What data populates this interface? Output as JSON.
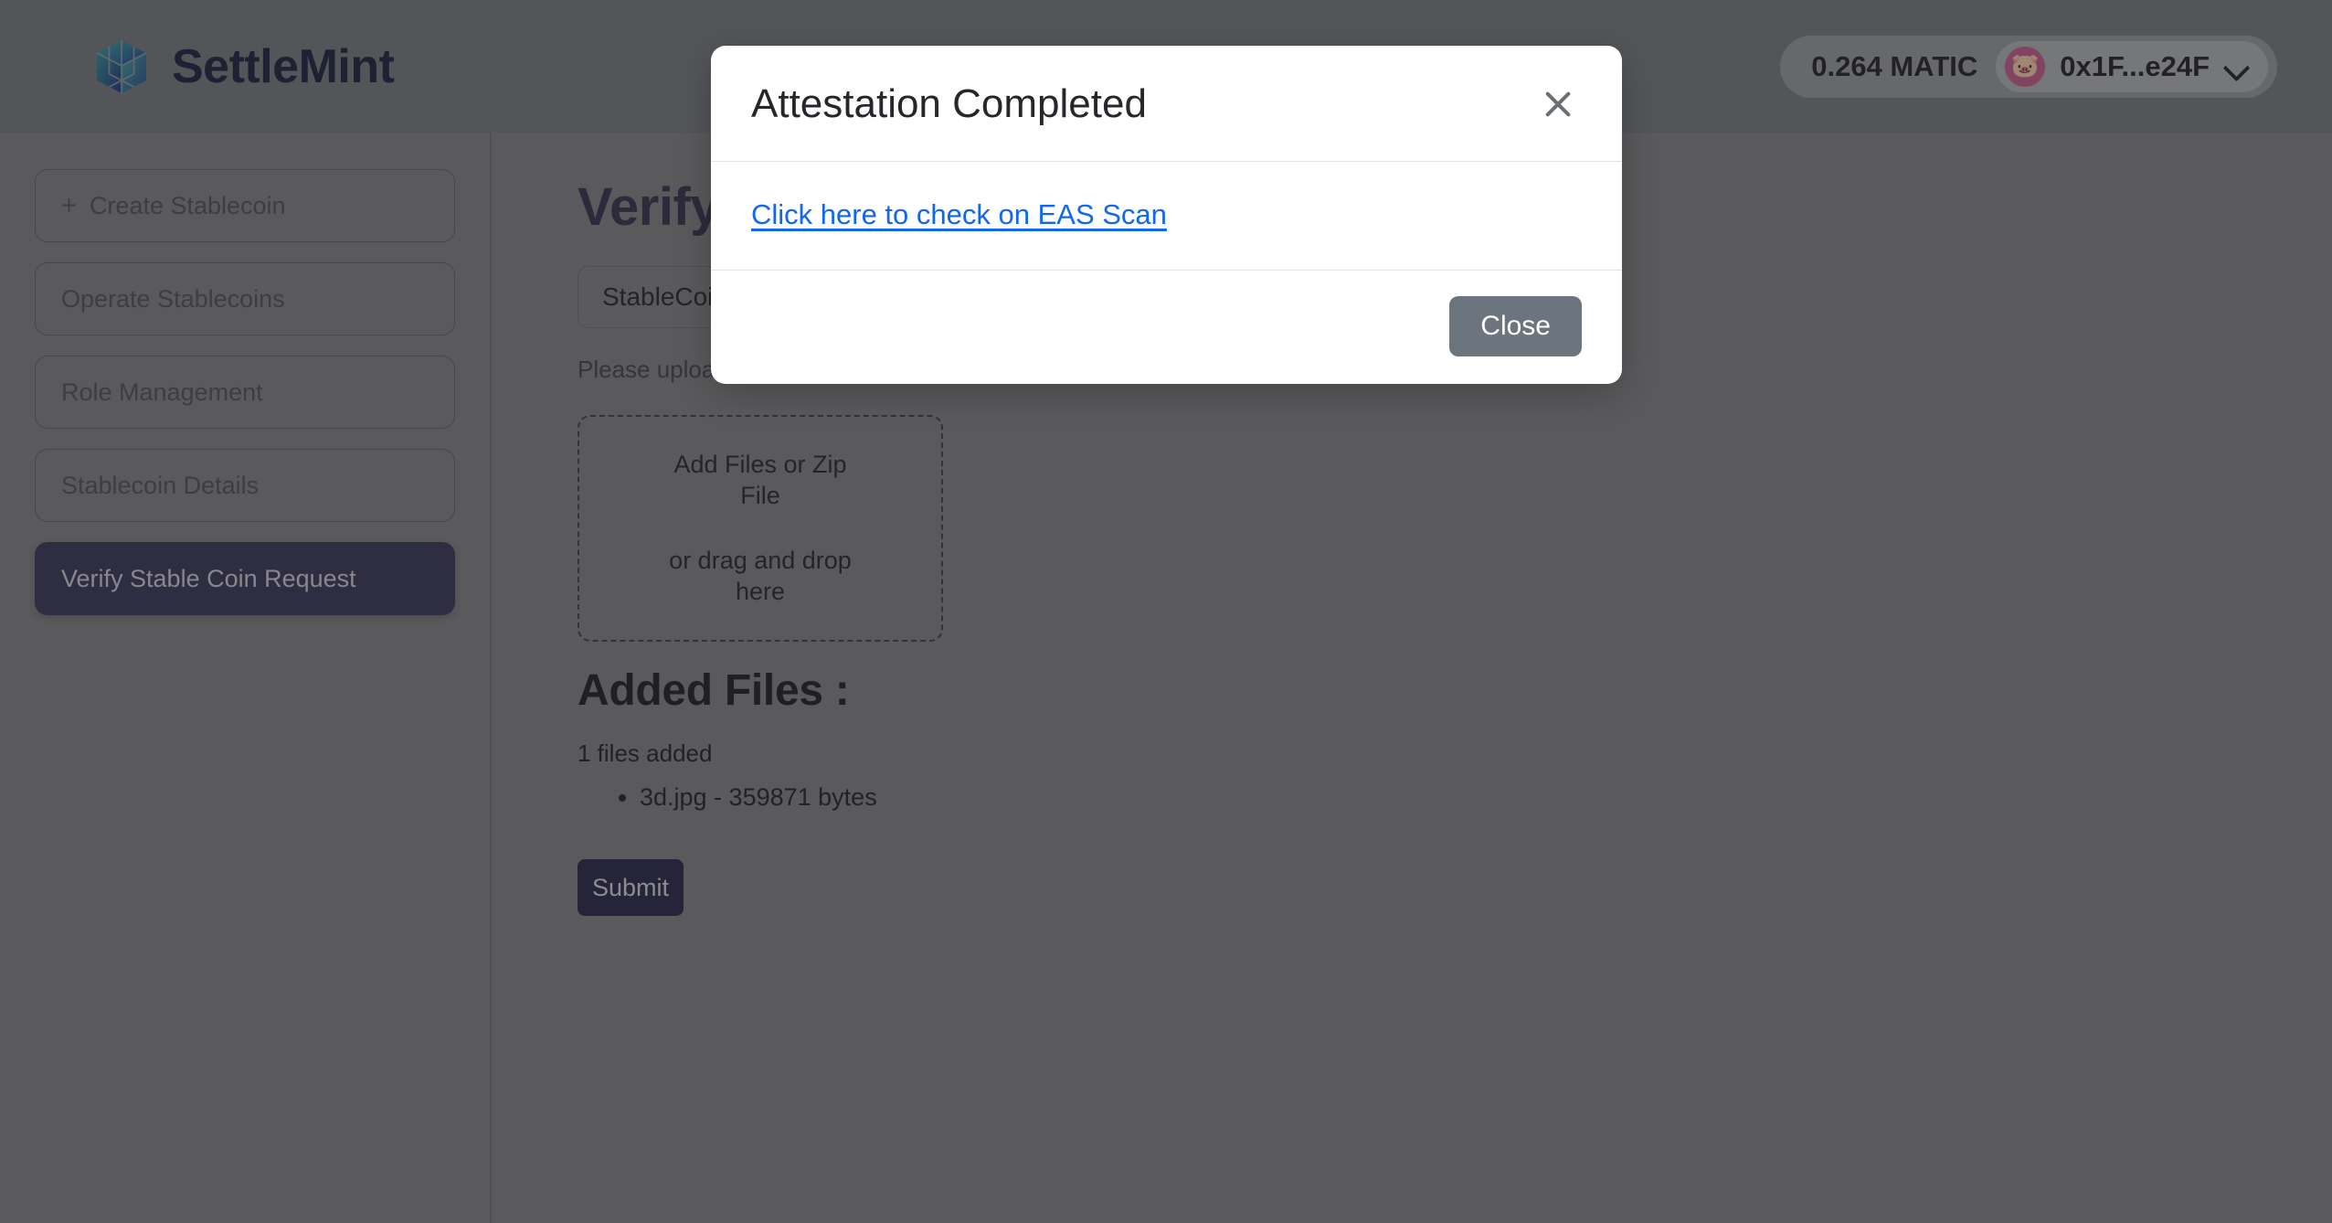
{
  "header": {
    "brand_name": "SettleMint",
    "brand_icon": "cube-logo-icon",
    "wallet": {
      "balance": "0.264 MATIC",
      "avatar_emoji": "🐷",
      "address": "0x1F...e24F",
      "chevron_icon": "chevron-down-icon"
    }
  },
  "sidebar": {
    "items": [
      {
        "label": "Create Stablecoin",
        "prefix": "+",
        "active": false
      },
      {
        "label": "Operate Stablecoins",
        "prefix": "",
        "active": false
      },
      {
        "label": "Role Management",
        "prefix": "",
        "active": false
      },
      {
        "label": "Stablecoin Details",
        "prefix": "",
        "active": false
      },
      {
        "label": "Verify Stable Coin Request",
        "prefix": "",
        "active": true
      }
    ]
  },
  "main": {
    "page_title": "Verify",
    "select_value": "StableCoin",
    "helper_text": "Please upload Certificate",
    "dropzone": {
      "primary_text": "Add Files or Zip File",
      "secondary_text": "or drag and drop here"
    },
    "added_files_title": "Added Files :",
    "files_count_text": "1 files added",
    "files": [
      "3d.jpg - 359871 bytes"
    ],
    "submit_label": "Submit"
  },
  "modal": {
    "title": "Attestation Completed",
    "close_icon": "close-x-icon",
    "link_text": "Click here to check on EAS Scan",
    "close_button_label": "Close"
  },
  "colors": {
    "brand_navy": "#131a36",
    "active_nav": "#343054",
    "submit": "#221f43",
    "link_blue": "#1266f1",
    "close_button": "#6c757d",
    "avatar_pink": "#c95c8e"
  }
}
